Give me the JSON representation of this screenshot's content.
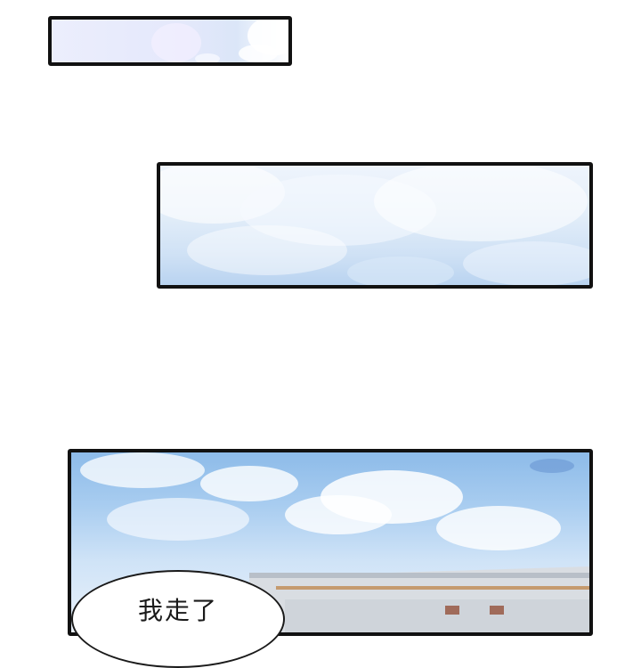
{
  "speech_bubble": {
    "text": "我走了"
  }
}
